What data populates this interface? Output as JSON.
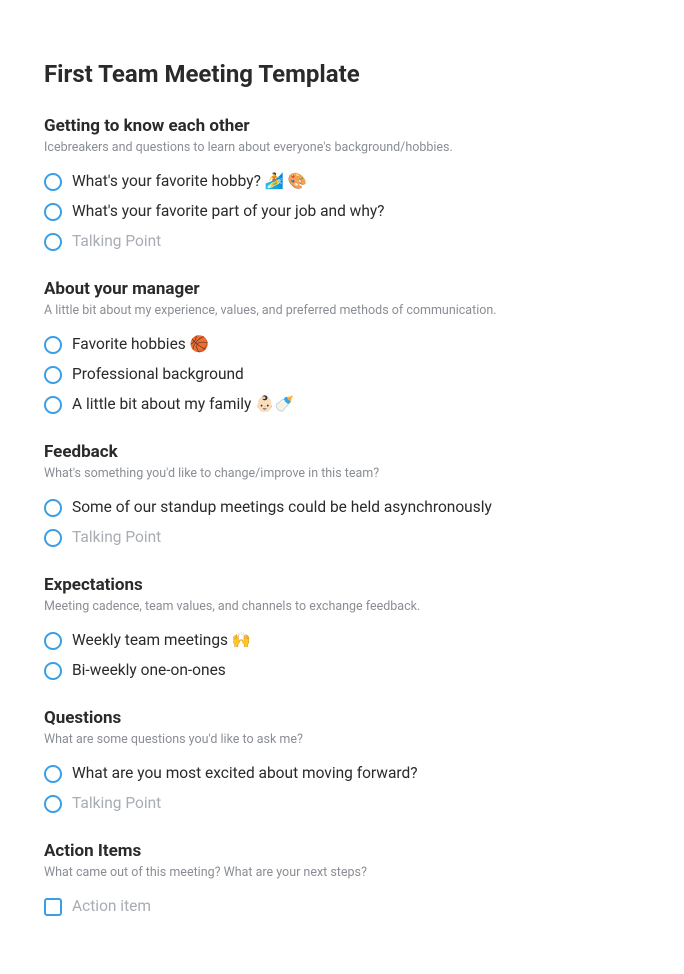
{
  "title": "First Team Meeting Template",
  "sections": [
    {
      "heading": "Getting to know each other",
      "description": "Icebreakers and questions to learn about everyone's background/hobbies.",
      "itemType": "circle",
      "items": [
        {
          "text": "What's your favorite hobby? 🏄 🎨",
          "placeholder": false
        },
        {
          "text": "What's your favorite part of your job and why?",
          "placeholder": false
        },
        {
          "text": "Talking Point",
          "placeholder": true
        }
      ]
    },
    {
      "heading": "About your manager",
      "description": "A little bit about my experience, values, and preferred methods of communication.",
      "itemType": "circle",
      "items": [
        {
          "text": "Favorite hobbies 🏀",
          "placeholder": false
        },
        {
          "text": "Professional background",
          "placeholder": false
        },
        {
          "text": "A little bit about my family 👶🏻🍼",
          "placeholder": false
        }
      ]
    },
    {
      "heading": "Feedback",
      "description": "What's something you'd like to change/improve in this team?",
      "itemType": "circle",
      "items": [
        {
          "text": "Some of our standup meetings could be held asynchronously",
          "placeholder": false
        },
        {
          "text": "Talking Point",
          "placeholder": true
        }
      ]
    },
    {
      "heading": "Expectations",
      "description": "Meeting cadence, team values, and channels to exchange feedback.",
      "itemType": "circle",
      "items": [
        {
          "text": "Weekly team meetings 🙌",
          "placeholder": false
        },
        {
          "text": "Bi-weekly one-on-ones",
          "placeholder": false
        }
      ]
    },
    {
      "heading": "Questions",
      "description": "What are some questions you'd like to ask me?",
      "itemType": "circle",
      "items": [
        {
          "text": "What are you most excited about moving forward?",
          "placeholder": false
        },
        {
          "text": "Talking Point",
          "placeholder": true
        }
      ]
    },
    {
      "heading": "Action Items",
      "description": "What came out of this meeting? What are your next steps?",
      "itemType": "square",
      "items": [
        {
          "text": "Action item",
          "placeholder": true
        }
      ]
    }
  ]
}
